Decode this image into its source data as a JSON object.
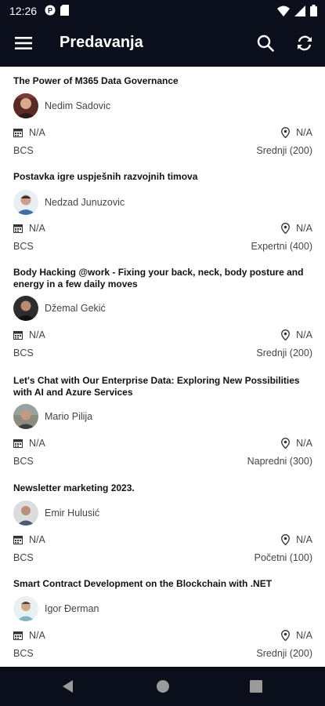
{
  "status_bar": {
    "time": "12:26"
  },
  "app_bar": {
    "title": "Predavanja"
  },
  "sessions": [
    {
      "title": "The Power of M365 Data Governance",
      "speaker": "Nedim Sadovic",
      "date": "N/A",
      "location": "N/A",
      "language": "BCS",
      "level": "Srednji (200)"
    },
    {
      "title": "Postavka igre uspješnih razvojnih timova",
      "speaker": "Nedzad Junuzovic",
      "date": "N/A",
      "location": "N/A",
      "language": "BCS",
      "level": "Expertni (400)"
    },
    {
      "title": "Body Hacking @work - Fixing your back, neck, body posture and energy in a few daily moves",
      "speaker": "Džemal Gekić",
      "date": "N/A",
      "location": "N/A",
      "language": "BCS",
      "level": "Srednji (200)"
    },
    {
      "title": "Let's Chat with Our Enterprise Data: Exploring New Possibilities with AI and Azure Services",
      "speaker": "Mario Pilija",
      "date": "N/A",
      "location": "N/A",
      "language": "BCS",
      "level": "Napredni (300)"
    },
    {
      "title": "Newsletter marketing 2023.",
      "speaker": "Emir Hulusić",
      "date": "N/A",
      "location": "N/A",
      "language": "BCS",
      "level": "Početni (100)"
    },
    {
      "title": "Smart Contract Development on the Blockchain with .NET",
      "speaker": "Igor Đerman",
      "date": "N/A",
      "location": "N/A",
      "language": "BCS",
      "level": "Srednji (200)"
    }
  ],
  "colors": {
    "app_bar": "#0b0f1c",
    "text": "#222222",
    "muted": "#444444",
    "divider": "#e2e2e2"
  }
}
